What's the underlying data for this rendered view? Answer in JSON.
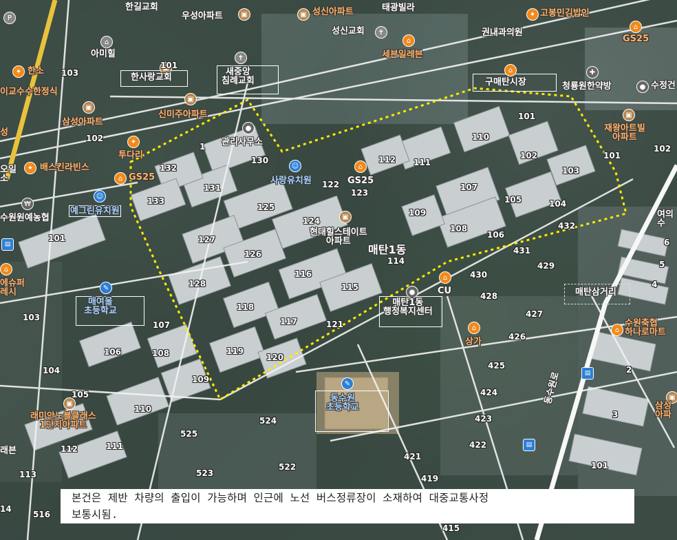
{
  "map": {
    "region_label": "매탄1동",
    "notice_line1": "본건은 제반 차량의 출입이 가능하며 인근에 노선 버스정류장이 소재하여 대중교통사정",
    "notice_line2": "보통시됨.",
    "places": {
      "hangil_church": "한길교회",
      "woosung_apt": "우성아파트",
      "sungsin_apt": "성신아파트",
      "taegwang_villa": "태광빌라",
      "gobong_kimbap": "고봉민김밥인",
      "sungsin_church": "성신교회",
      "kwonnae_clinic": "권내과의원",
      "gs25_top": "GS25",
      "ami_hill": "아미힐",
      "seven_eleven": "세븐일레븐",
      "hansarang_church": "한사랑교회",
      "saejungang_church": "새중앙\n침례교회",
      "gumaetan_market": "구매탄시장",
      "chungsaengwon": "청룡원한약방",
      "hanso": "한소",
      "leeprof": "이교수수한정식",
      "sinmiju_apt": "신미주아파트",
      "samsung_apt": "삼성아파트",
      "jaewang_apt": "재왕아트빌\n아파트",
      "tudari": "투다리",
      "management": "관리사무소",
      "baskin": "배스킨라빈스",
      "gs25_left": "GS25",
      "sarang_kindergarten": "사랑유치원",
      "gs25_mid": "GS25",
      "yegreen_kindergarten": "예그린유치원",
      "suwon_nh": "수원원예농협",
      "hyundai_hills": "현대힐스테이트\n아파트",
      "maetan_elementary": "매여울\n초등학교",
      "cu": "CU",
      "welfare_center": "매탄1동\n행정복지센터",
      "maetan_junction": "매탄삼거리",
      "sangga": "상가",
      "suwon_church": "수원축협\n하나로마트",
      "dongsuwon_elementary": "동수원\n초등학교",
      "raemian": "래미안노블클래스\n1단지아파트",
      "samsung_right": "삼성\n아파",
      "sujeong": "수정건",
      "ilsu": "에슈퍼\n레시",
      "left_o": "오일\n소",
      "right_yeo": "여의\n수",
      "left_g": "성",
      "bottom_left": "래븐",
      "dongsu_road": "동수원로"
    },
    "buildings": [
      "101",
      "102",
      "103",
      "104",
      "105",
      "106",
      "107",
      "108",
      "109",
      "110",
      "111",
      "112",
      "114",
      "115",
      "116",
      "117",
      "118",
      "119",
      "120",
      "121",
      "122",
      "123",
      "124",
      "125",
      "126",
      "127",
      "128",
      "130",
      "131",
      "132",
      "133",
      "421",
      "422",
      "423",
      "424",
      "425",
      "426",
      "427",
      "428",
      "429",
      "430",
      "431",
      "432",
      "513",
      "516",
      "522",
      "523",
      "524",
      "525",
      "415",
      "419",
      "1",
      "2",
      "3",
      "4",
      "5",
      "6"
    ],
    "colors": {
      "boundary": "#ffeb00",
      "orange_pin": "#f08a1c",
      "blue_pin": "#2d7fd6"
    }
  }
}
